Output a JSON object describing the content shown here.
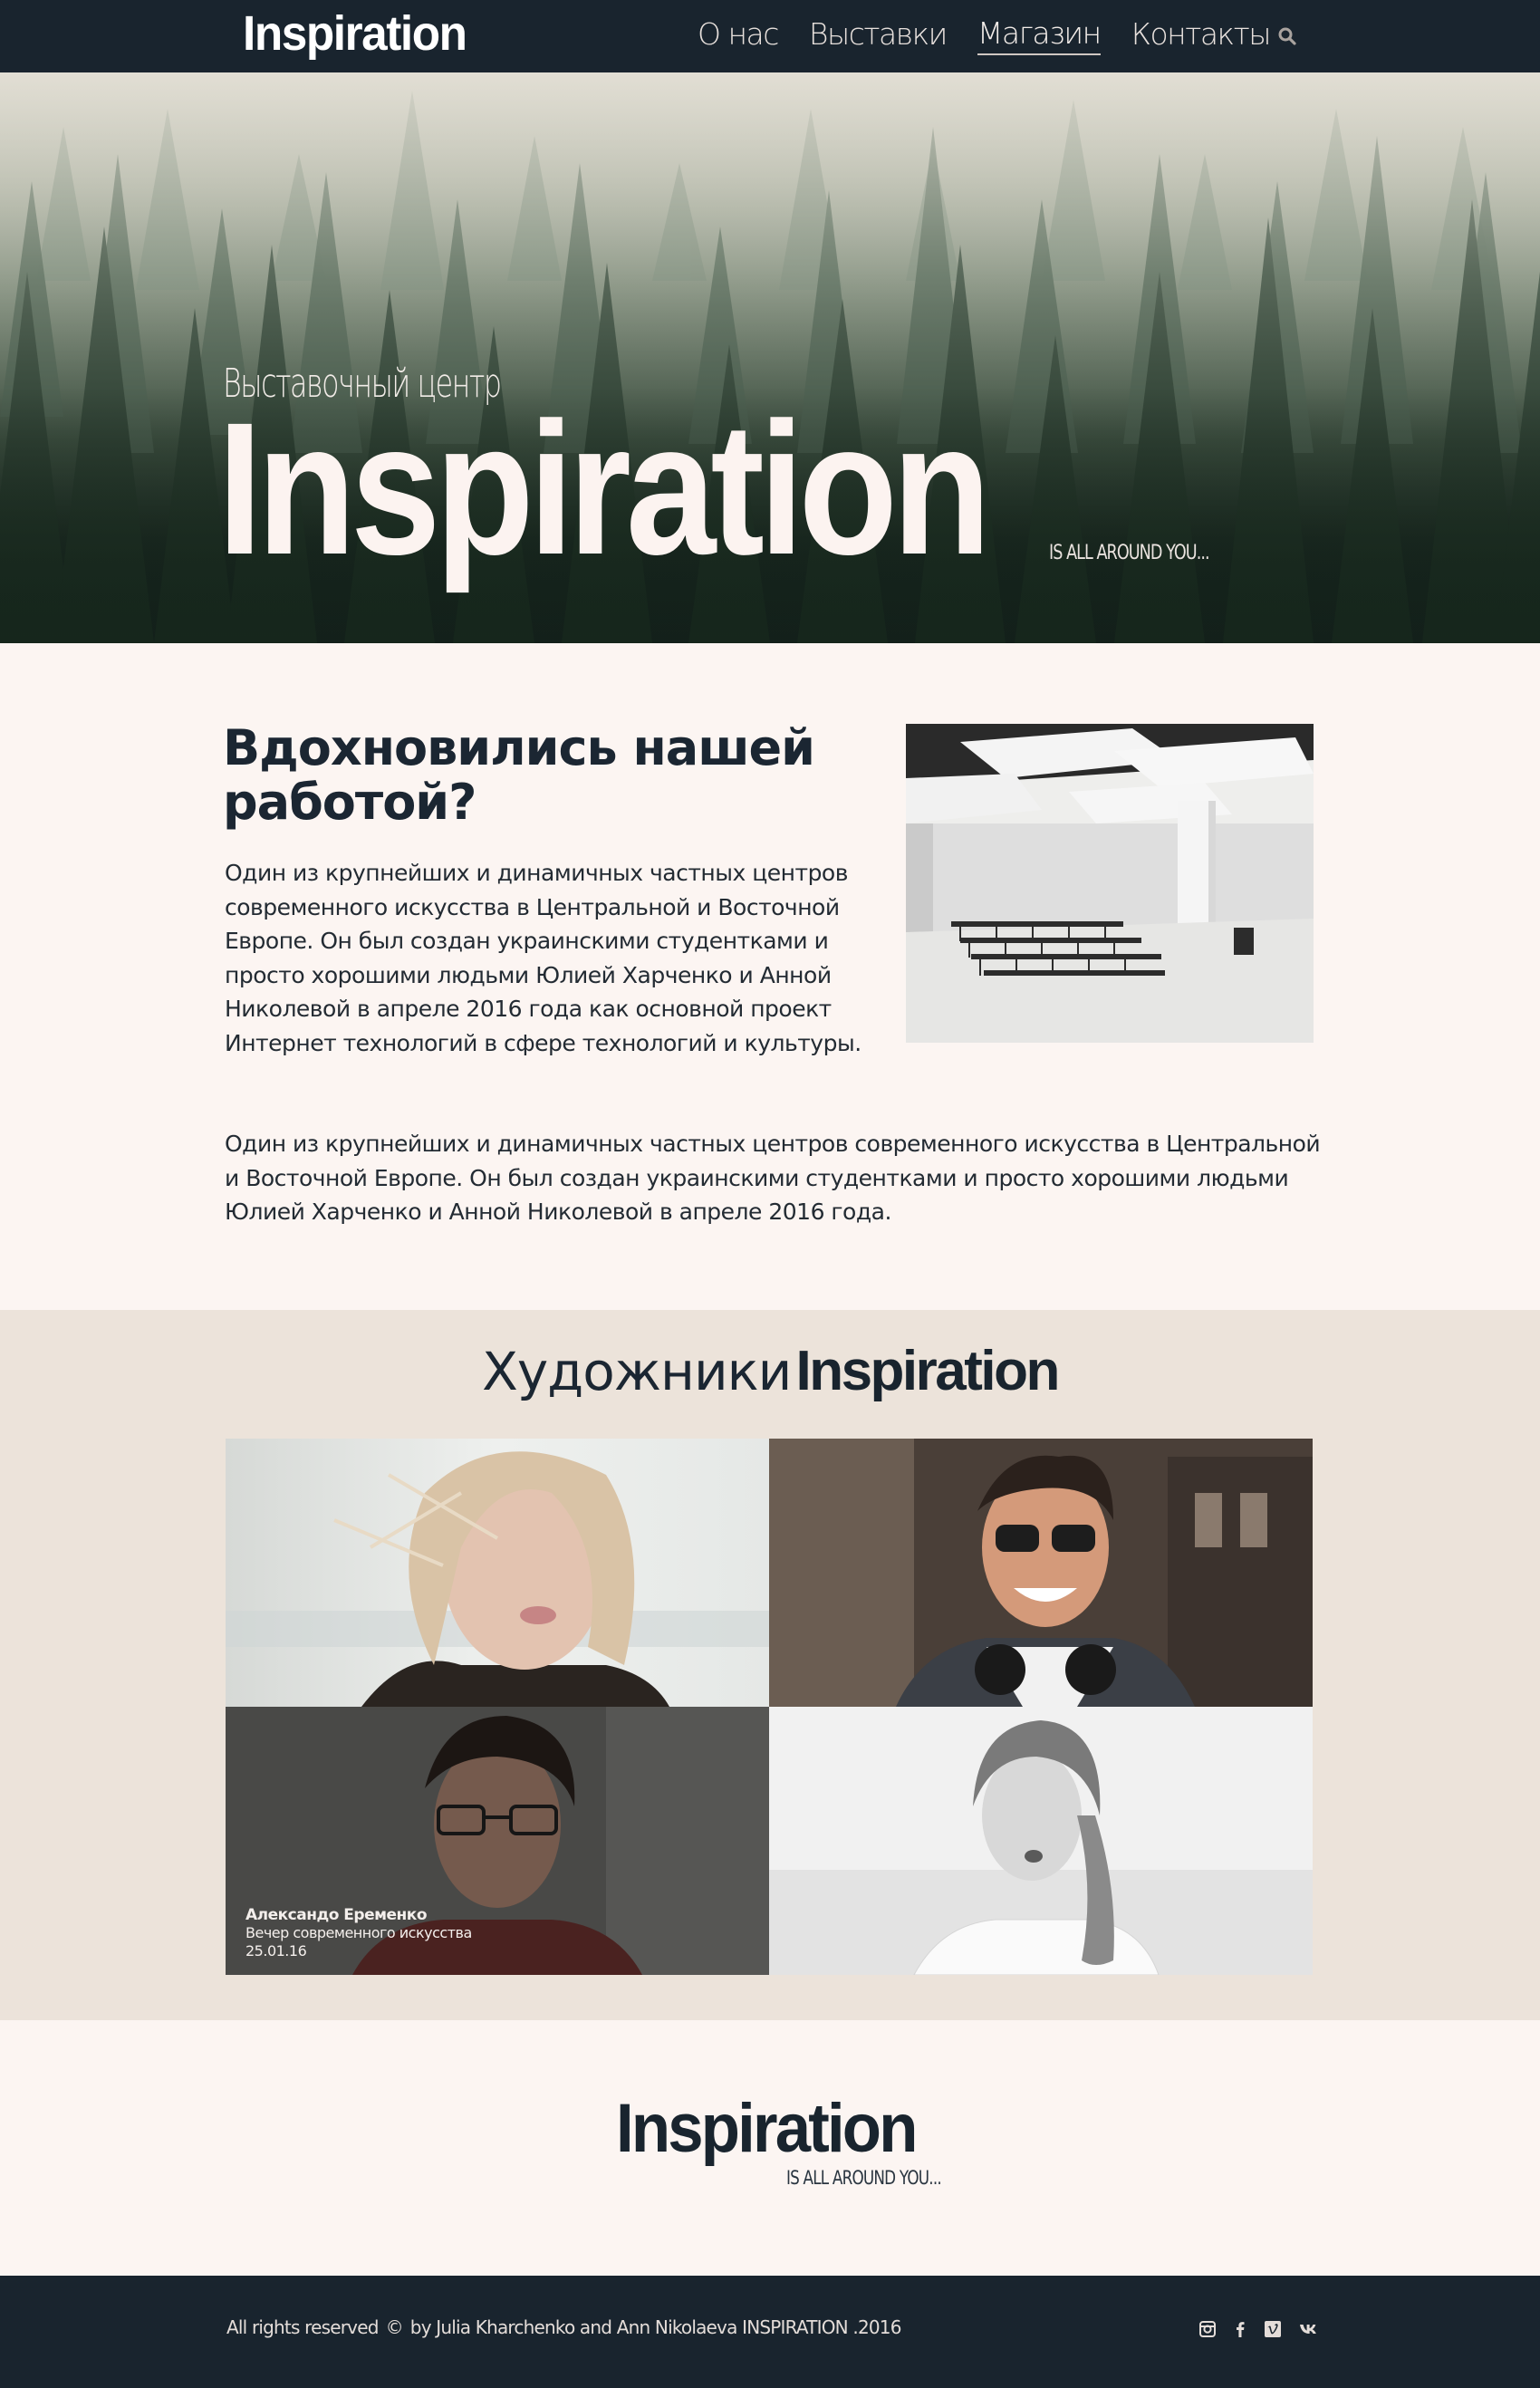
{
  "nav": {
    "logo": "Inspiration",
    "items": [
      {
        "label": "О нас"
      },
      {
        "label": "Выставки"
      },
      {
        "label": "Магазин"
      },
      {
        "label": "Контакты"
      }
    ],
    "active_item": "Магазин",
    "search_icon": "search-icon"
  },
  "hero": {
    "subtitle": "Выставочный центр",
    "title": "Inspiration",
    "tagline": "IS ALL AROUND YOU..."
  },
  "about": {
    "title": "Вдохновились нашей работой?",
    "paragraph1": "Один из крупнейших и динамичных частных центров современного искусства в Центральной и Восточной Европе. Он был создан украинскими студентками и просто хорошими людьми Юлией Харченко и Анной Николевой в апреле 2016 года как основной проект Интернет технологий в сфере технологий и культуры.",
    "paragraph2": "Один из крупнейших и динамичных частных центров современного искусства в Центральной и Восточной Европе. Он был создан украинскими студентками и просто хорошими людьми Юлией Харченко и Анной Николевой в апреле 2016 года."
  },
  "artists": {
    "heading_word": "Художники",
    "heading_brand": "Inspiration",
    "highlight": {
      "name": "Александо Еременко",
      "event": "Вечер современного искусства",
      "date": "25.01.16"
    }
  },
  "footer": {
    "logo": "Inspiration",
    "tagline": "IS ALL AROUND YOU...",
    "rights": "All rights reserved",
    "copyright_symbol": "©",
    "credits": "by Julia Kharchenko and Ann Nikolaeva  INSPIRATION .2016",
    "socials": [
      "instagram-icon",
      "facebook-icon",
      "vimeo-icon",
      "vk-icon"
    ]
  },
  "colors": {
    "navy": "#19242e",
    "page_bg": "#fcf5f2",
    "artists_bg": "#ece3da"
  }
}
